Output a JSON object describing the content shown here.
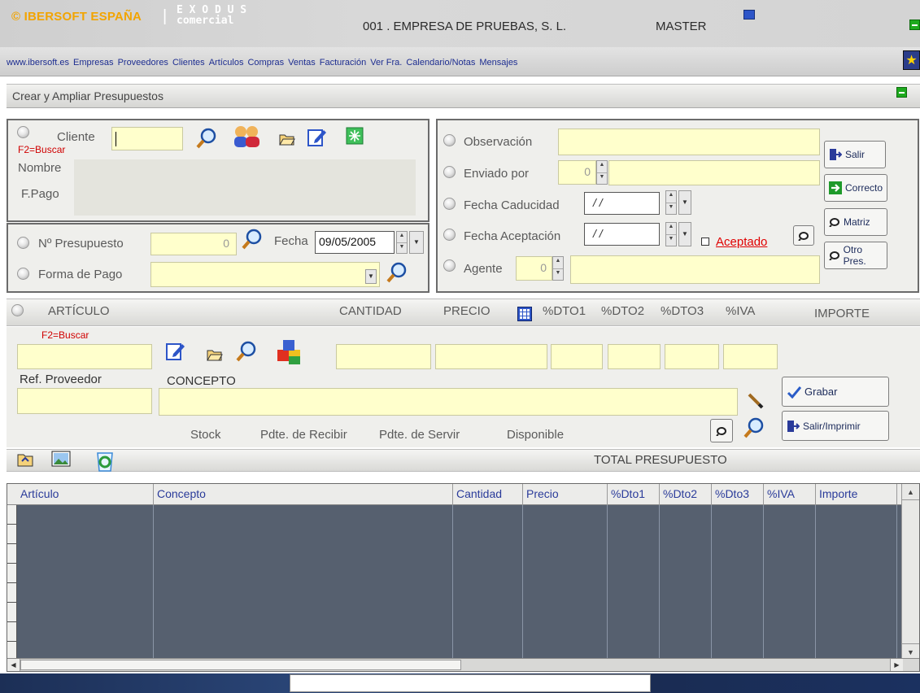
{
  "header": {
    "brand": "© IBERSOFT ESPAÑA",
    "separator": "|",
    "product_top": "E X O D U S",
    "product_bottom": "comercial",
    "company": "001 . EMPRESA DE PRUEBAS, S. L.",
    "user": "MASTER"
  },
  "nav": {
    "items": [
      "www.ibersoft.es",
      "Empresas",
      "Proveedores",
      "Clientes",
      "Artículos",
      "Compras",
      "Ventas",
      "Facturación",
      "Ver Fra.",
      "Calendario/Notas",
      "Mensajes"
    ]
  },
  "window": {
    "title": "Crear y Ampliar Presupuestos"
  },
  "client_panel": {
    "cliente_label": "Cliente",
    "buscar_hint": "F2=Buscar",
    "nombre_label": "Nombre",
    "fpago_label": "F.Pago",
    "cliente_value": ""
  },
  "budget_panel": {
    "numero_label": "Nº Presupuesto",
    "numero_value": "0",
    "fecha_label": "Fecha",
    "fecha_value": "09/05/2005",
    "forma_pago_label": "Forma de Pago",
    "forma_pago_value": ""
  },
  "obs_panel": {
    "observacion_label": "Observación",
    "enviado_label": "Enviado por",
    "enviado_value": "0",
    "caducidad_label": "Fecha Caducidad",
    "caducidad_value": "/ /",
    "aceptacion_label": "Fecha Aceptación",
    "aceptacion_value": "/ /",
    "aceptado_label": "Aceptado",
    "agente_label": "Agente",
    "agente_value": "0"
  },
  "side_buttons": {
    "salir": "Salir",
    "correcto": "Correcto",
    "matriz": "Matriz",
    "otro": "Otro Pres."
  },
  "article_header": {
    "articulo": "ARTÍCULO",
    "cantidad": "CANTIDAD",
    "precio": "PRECIO",
    "dto1": "%DTO1",
    "dto2": "%DTO2",
    "dto3": "%DTO3",
    "iva": "%IVA",
    "importe": "IMPORTE"
  },
  "article_panel": {
    "buscar_hint": "F2=Buscar",
    "ref_label": "Ref. Proveedor",
    "concepto_label": "CONCEPTO",
    "stock_label": "Stock",
    "pdte_recibir_label": "Pdte. de Recibir",
    "pdte_servir_label": "Pdte. de Servir",
    "disponible_label": "Disponible",
    "grabar": "Grabar",
    "salir_imprimir": "Salir/Imprimir"
  },
  "total": {
    "label": "TOTAL PRESUPUESTO"
  },
  "grid": {
    "columns": [
      "Artículo",
      "Concepto",
      "Cantidad",
      "Precio",
      "%Dto1",
      "%Dto2",
      "%Dto3",
      "%IVA",
      "Importe"
    ]
  },
  "colors": {
    "input_yellow": "#ffffcc",
    "grid_bg": "#56606f",
    "link_blue": "#2a3b9a",
    "aceptado_red": "#e00000",
    "minimize_green": "#1eaa1e"
  }
}
